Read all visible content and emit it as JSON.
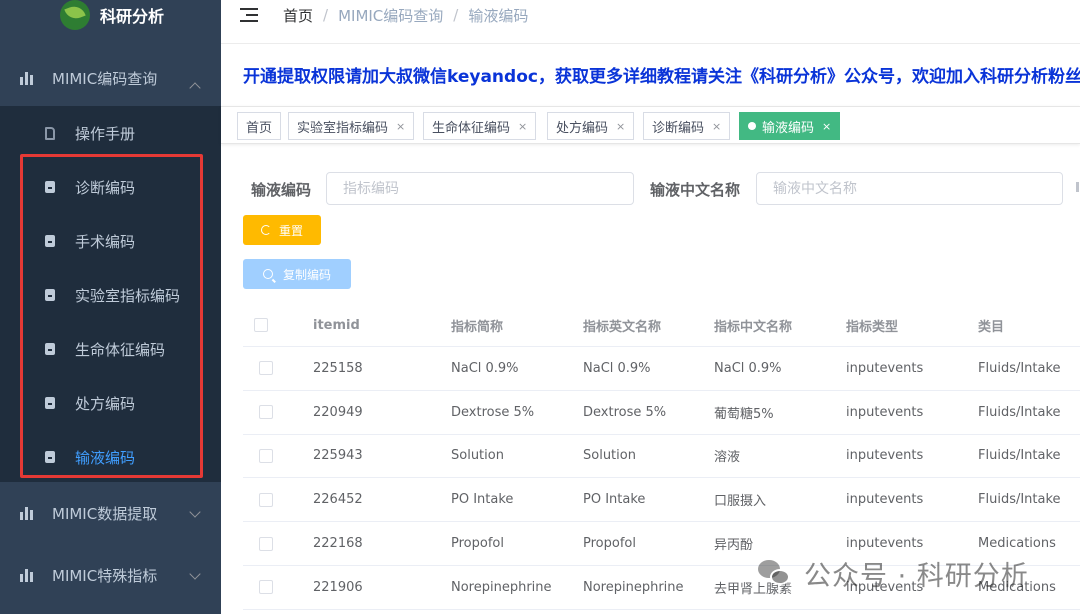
{
  "app": {
    "title": "科研分析"
  },
  "sidebar": {
    "groups": [
      {
        "label": "MIMIC编码查询",
        "expanded": true
      },
      {
        "label": "MIMIC数据提取",
        "expanded": false
      },
      {
        "label": "MIMIC特殊指标",
        "expanded": false
      }
    ],
    "items": [
      {
        "label": "操作手册",
        "icon": "document-outline-icon",
        "active": false
      },
      {
        "label": "诊断编码",
        "icon": "document-icon",
        "active": false
      },
      {
        "label": "手术编码",
        "icon": "document-icon",
        "active": false
      },
      {
        "label": "实验室指标编码",
        "icon": "document-icon",
        "active": false
      },
      {
        "label": "生命体征编码",
        "icon": "document-icon",
        "active": false
      },
      {
        "label": "处方编码",
        "icon": "document-icon",
        "active": false
      },
      {
        "label": "输液编码",
        "icon": "document-icon",
        "active": true
      }
    ]
  },
  "breadcrumb": [
    "首页",
    "MIMIC编码查询",
    "输液编码"
  ],
  "notice": "开通提取权限请加大叔微信keyandoc，获取更多详细教程请关注《科研分析》公众号，欢迎加入科研分析粉丝",
  "tags": [
    {
      "label": "首页",
      "closable": false,
      "active": false
    },
    {
      "label": "实验室指标编码",
      "closable": true,
      "active": false
    },
    {
      "label": "生命体征编码",
      "closable": true,
      "active": false
    },
    {
      "label": "处方编码",
      "closable": true,
      "active": false
    },
    {
      "label": "诊断编码",
      "closable": true,
      "active": false
    },
    {
      "label": "输液编码",
      "closable": true,
      "active": true
    }
  ],
  "tag_close": "×",
  "form": {
    "code_label": "输液编码",
    "code_placeholder": "指标编码",
    "name_label": "输液中文名称",
    "name_placeholder": "输液中文名称",
    "reset_label": "重置",
    "copy_label": "复制编码"
  },
  "table": {
    "columns": [
      "itemid",
      "指标简称",
      "指标英文名称",
      "指标中文名称",
      "指标类型",
      "类目"
    ],
    "rows": [
      [
        "225158",
        "NaCl 0.9%",
        "NaCl 0.9%",
        "NaCl 0.9%",
        "inputevents",
        "Fluids/Intake"
      ],
      [
        "220949",
        "Dextrose 5%",
        "Dextrose 5%",
        "葡萄糖5%",
        "inputevents",
        "Fluids/Intake"
      ],
      [
        "225943",
        "Solution",
        "Solution",
        "溶液",
        "inputevents",
        "Fluids/Intake"
      ],
      [
        "226452",
        "PO Intake",
        "PO Intake",
        "口服摄入",
        "inputevents",
        "Fluids/Intake"
      ],
      [
        "222168",
        "Propofol",
        "Propofol",
        "异丙酚",
        "inputevents",
        "Medications"
      ],
      [
        "221906",
        "Norepinephrine",
        "Norepinephrine",
        "去甲肾上腺素",
        "inputevents",
        "Medications"
      ]
    ]
  },
  "watermark": "公众号 · 科研分析",
  "colors": {
    "sidebar_bg": "#304156",
    "submenu_bg": "#1f2d3d",
    "active_link": "#409eff",
    "active_tag": "#42b983",
    "reset_button": "#ffba00",
    "copy_button": "#a0cfff",
    "notice_text": "#0a34d8",
    "highlight_box": "#e53935"
  }
}
